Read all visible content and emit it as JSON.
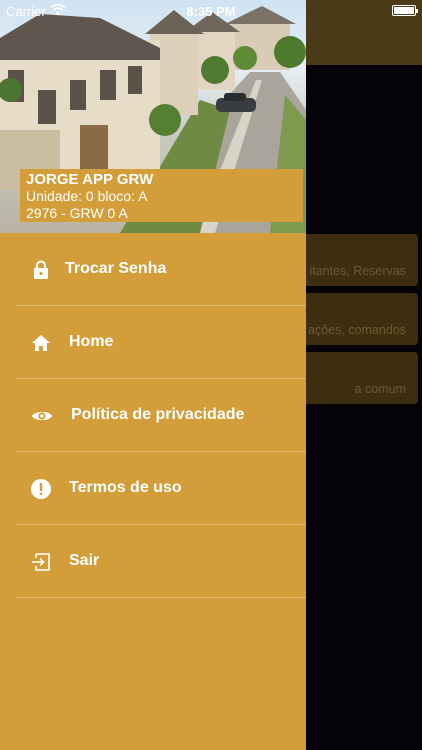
{
  "status_bar": {
    "carrier": "Carrier",
    "time": "8:35 PM"
  },
  "user": {
    "name": "JORGE APP GRW",
    "unit": "Unidade: 0 bloco: A",
    "code": "2976 - GRW 0 A"
  },
  "menu": {
    "items": [
      {
        "label": "Trocar Senha",
        "icon": "lock-icon"
      },
      {
        "label": "Home",
        "icon": "home-icon"
      },
      {
        "label": "Política de privacidade",
        "icon": "eye-icon"
      },
      {
        "label": "Termos de uso",
        "icon": "alert-icon"
      },
      {
        "label": "Sair",
        "icon": "logout-icon"
      }
    ]
  },
  "background_cards": [
    {
      "subtitle": "itantes, Reservas"
    },
    {
      "subtitle": "ações, comandos"
    },
    {
      "subtitle": "a comum"
    }
  ],
  "colors": {
    "accent": "#d39e3a",
    "header": "#4a3a18",
    "background": "#050307"
  }
}
